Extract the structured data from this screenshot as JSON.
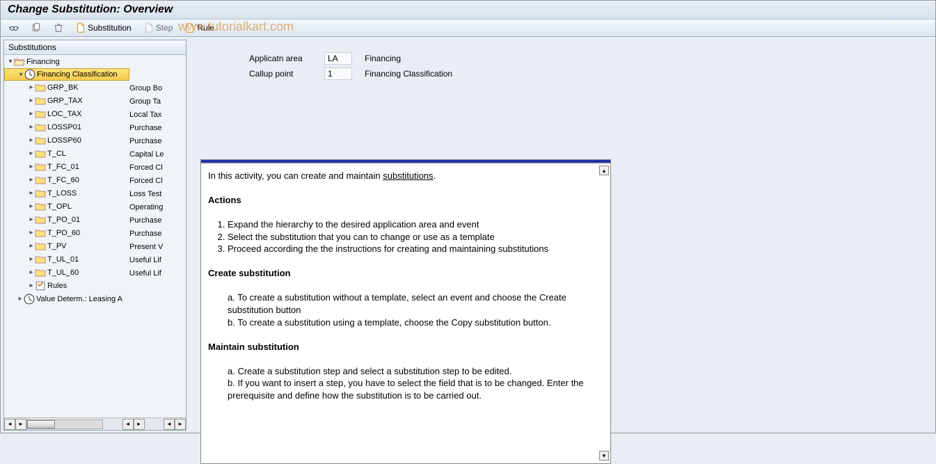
{
  "title": "Change Substitution: Overview",
  "watermark": "www.tutorialkart.com",
  "toolbar": {
    "substitution_label": "Substitution",
    "step_label": "Step",
    "rule_label": "Rule"
  },
  "tree": {
    "header": "Substitutions",
    "root": {
      "label": "Financing"
    },
    "selected": {
      "label": "Financing Classification"
    },
    "items": [
      {
        "name": "GRP_BK",
        "desc": "Group Bo"
      },
      {
        "name": "GRP_TAX",
        "desc": "Group Ta"
      },
      {
        "name": "LOC_TAX",
        "desc": "Local Tax"
      },
      {
        "name": "LOSSP01",
        "desc": "Purchase"
      },
      {
        "name": "LOSSP60",
        "desc": "Purchase"
      },
      {
        "name": "T_CL",
        "desc": "Capital Le"
      },
      {
        "name": "T_FC_01",
        "desc": "Forced Cl"
      },
      {
        "name": "T_FC_60",
        "desc": "Forced Cl"
      },
      {
        "name": "T_LOSS",
        "desc": "Loss Test"
      },
      {
        "name": "T_OPL",
        "desc": "Operating"
      },
      {
        "name": "T_PO_01",
        "desc": "Purchase"
      },
      {
        "name": "T_PO_60",
        "desc": "Purchase"
      },
      {
        "name": "T_PV",
        "desc": "Present V"
      },
      {
        "name": "T_UL_01",
        "desc": "Useful Lif"
      },
      {
        "name": "T_UL_60",
        "desc": "Useful Lif"
      }
    ],
    "rules": {
      "label": "Rules"
    },
    "other": {
      "label": "Value Determ.: Leasing A"
    }
  },
  "info": {
    "area_label": "Applicatn area",
    "area_value": "LA",
    "area_desc": "Financing",
    "callup_label": "Callup point",
    "callup_value": "1",
    "callup_desc": "Financing Classification"
  },
  "doc": {
    "intro_pre": "In this activity, you can create and maintain ",
    "intro_link": "substitutions",
    "intro_post": ".",
    "h_actions": "Actions",
    "a1": "Expand the hierarchy to the desired application area and event",
    "a2": "Select the substitution that you can to change or use as a template",
    "a3": "Proceed according the the instructions for creating and maintaining substitutions",
    "h_create": "Create substitution",
    "c_a": "a. To create a substitution without a template, select an event and choose the Create substitution button",
    "c_b": "b. To create a substitution using a template, choose the Copy substitution button.",
    "h_maintain": "Maintain substitution",
    "m_a": "a. Create a substitution step and select a substitution step to be edited.",
    "m_b": "b. If you want to insert a step, you have to select the field that is to be changed. Enter the prerequisite and define how the substitution is to be carried out."
  }
}
